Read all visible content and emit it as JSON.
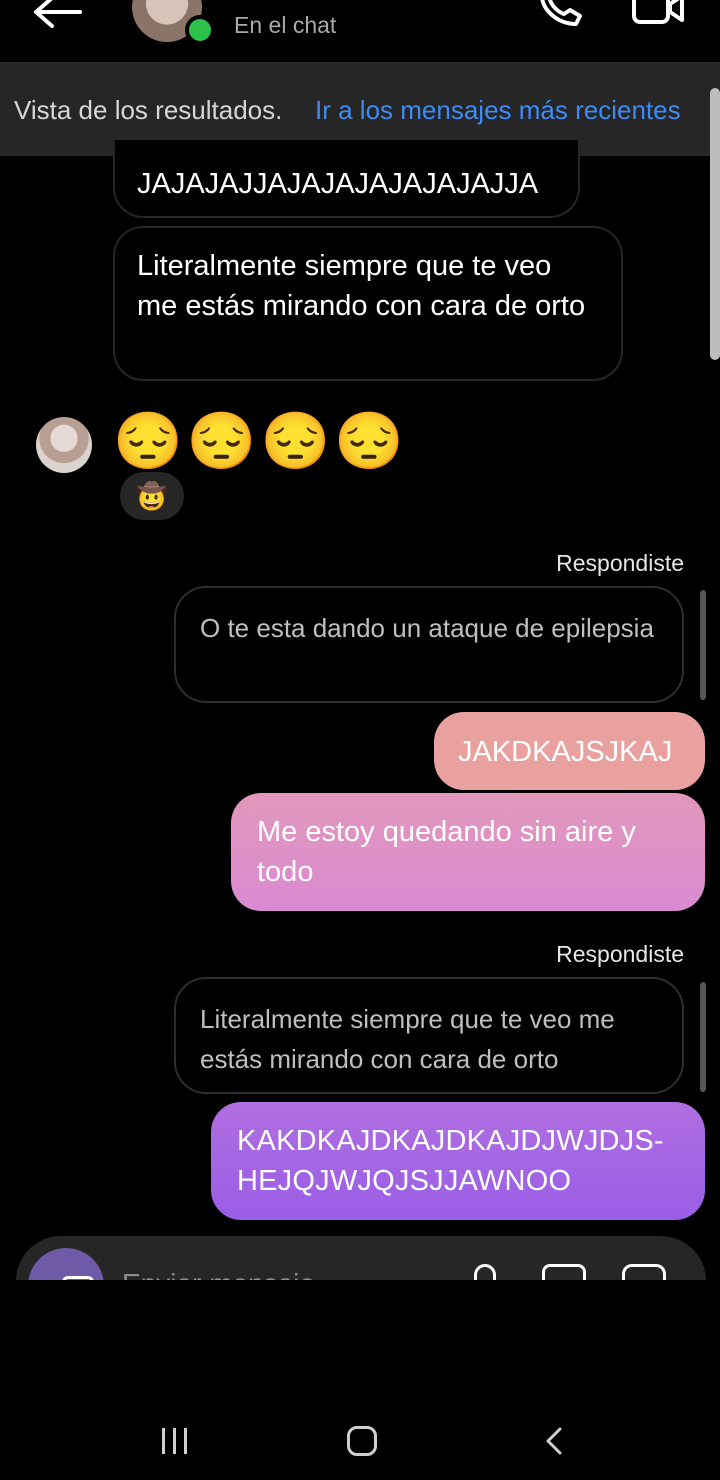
{
  "header": {
    "status": "En el chat",
    "icons": [
      "back-arrow-icon",
      "phone-icon",
      "video-camera-icon"
    ],
    "online_color": "#2bc14a"
  },
  "banner": {
    "label": "Vista de los resultados.",
    "link": "Ir a los mensajes más recientes",
    "link_color": "#3d8bf5"
  },
  "messages": {
    "incoming": [
      {
        "text": "JAJAJAJJAJAJAJAJAJAJAJJA"
      },
      {
        "text": "Literalmente siempre que te veo me estás mirando con cara de orto"
      },
      {
        "text": "😔😔😔😔",
        "reaction": "🤠"
      }
    ],
    "replied_label": "Respondiste",
    "quote1": "O te esta dando un ataque de epilepsia",
    "out1": "JAKDKAJSJKAJ",
    "out2": "Me estoy quedando sin aire y todo",
    "quote2": "Literalmente siempre que te veo me estás mirando con cara de orto",
    "out3": "KAKDKAJDKAJDKAJDJWJDJS-HEJQJWJQJSJJAWNOO"
  },
  "composer": {
    "placeholder": "Enviar mensaje...",
    "icons": [
      "camera-icon",
      "microphone-icon",
      "gallery-icon",
      "sticker-icon"
    ],
    "camera_color": "#6e5aa6"
  },
  "navbar": {
    "icons": [
      "recent-apps-icon",
      "home-icon",
      "back-icon"
    ]
  }
}
